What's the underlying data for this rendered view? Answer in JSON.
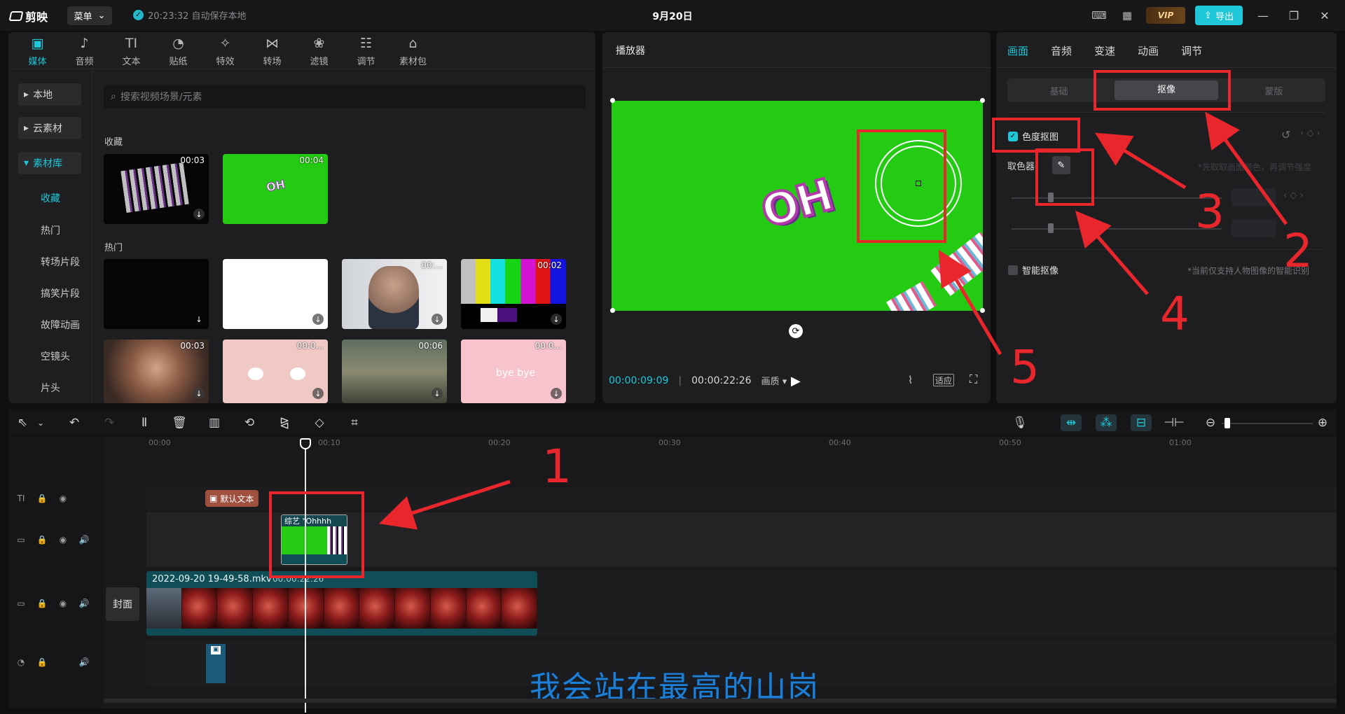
{
  "app": {
    "name": "剪映",
    "menu_label": "菜单",
    "autosave": "20:23:32 自动保存本地",
    "project_title": "9月20日",
    "vip_label": "VIP",
    "export_label": "导出"
  },
  "media": {
    "tabs": [
      {
        "label": "媒体",
        "icon": "media-icon"
      },
      {
        "label": "音频",
        "icon": "audio-icon"
      },
      {
        "label": "文本",
        "icon": "text-icon"
      },
      {
        "label": "贴纸",
        "icon": "sticker-icon"
      },
      {
        "label": "特效",
        "icon": "effects-icon"
      },
      {
        "label": "转场",
        "icon": "transition-icon"
      },
      {
        "label": "滤镜",
        "icon": "filter-icon"
      },
      {
        "label": "调节",
        "icon": "adjust-icon"
      },
      {
        "label": "素材包",
        "icon": "pack-icon"
      }
    ],
    "side_buttons": [
      "本地",
      "云素材",
      "素材库"
    ],
    "side_subitems": [
      "收藏",
      "热门",
      "转场片段",
      "搞笑片段",
      "故障动画",
      "空镜头",
      "片头"
    ],
    "search_placeholder": "搜索视频场景/元素",
    "section_favorites": "收藏",
    "section_hot": "热门",
    "favorites": [
      {
        "duration": "00:03"
      },
      {
        "duration": "00:04",
        "caption": "OH"
      }
    ],
    "hot": [
      {
        "duration": ""
      },
      {
        "duration": ""
      },
      {
        "duration": "00:..."
      },
      {
        "duration": "00:02"
      },
      {
        "duration": "00:03"
      },
      {
        "duration": "00:0..."
      },
      {
        "duration": "00:06"
      },
      {
        "duration": "00:0...",
        "caption": "bye bye"
      }
    ]
  },
  "player": {
    "title": "播放器",
    "frame_text": "OH",
    "time_current": "00:00:09:09",
    "time_total": "00:00:22:26",
    "quality_label": "画质",
    "fit_label": "适应"
  },
  "properties": {
    "tabs": [
      "画面",
      "音频",
      "变速",
      "动画",
      "调节"
    ],
    "segments": [
      "基础",
      "抠像",
      "蒙版"
    ],
    "chroma_label": "色度抠图",
    "picker_label": "取色器",
    "picker_hint": "*先取取画面颜色，再调节强度",
    "smart_label": "智能抠像",
    "smart_hint": "*当前仅支持人物图像的智能识别"
  },
  "timeline": {
    "ruler": [
      "00:00",
      "00:10",
      "00:20",
      "00:30",
      "00:40",
      "00:50",
      "01:00"
    ],
    "text_clip": "默认文本",
    "green_clip_label": "综艺 \"Ohhhh",
    "main_clip_name": "2022-09-20 19-49-58.mkv",
    "main_clip_time": "00:00:22:26",
    "cover_label": "封面",
    "subtitle": "我会站在最高的山岗"
  },
  "annotations": [
    "1",
    "2",
    "3",
    "4",
    "5"
  ],
  "colors": {
    "accent": "#1ec8d8",
    "annotation_red": "#e8262c",
    "green_screen": "#23cc12"
  }
}
